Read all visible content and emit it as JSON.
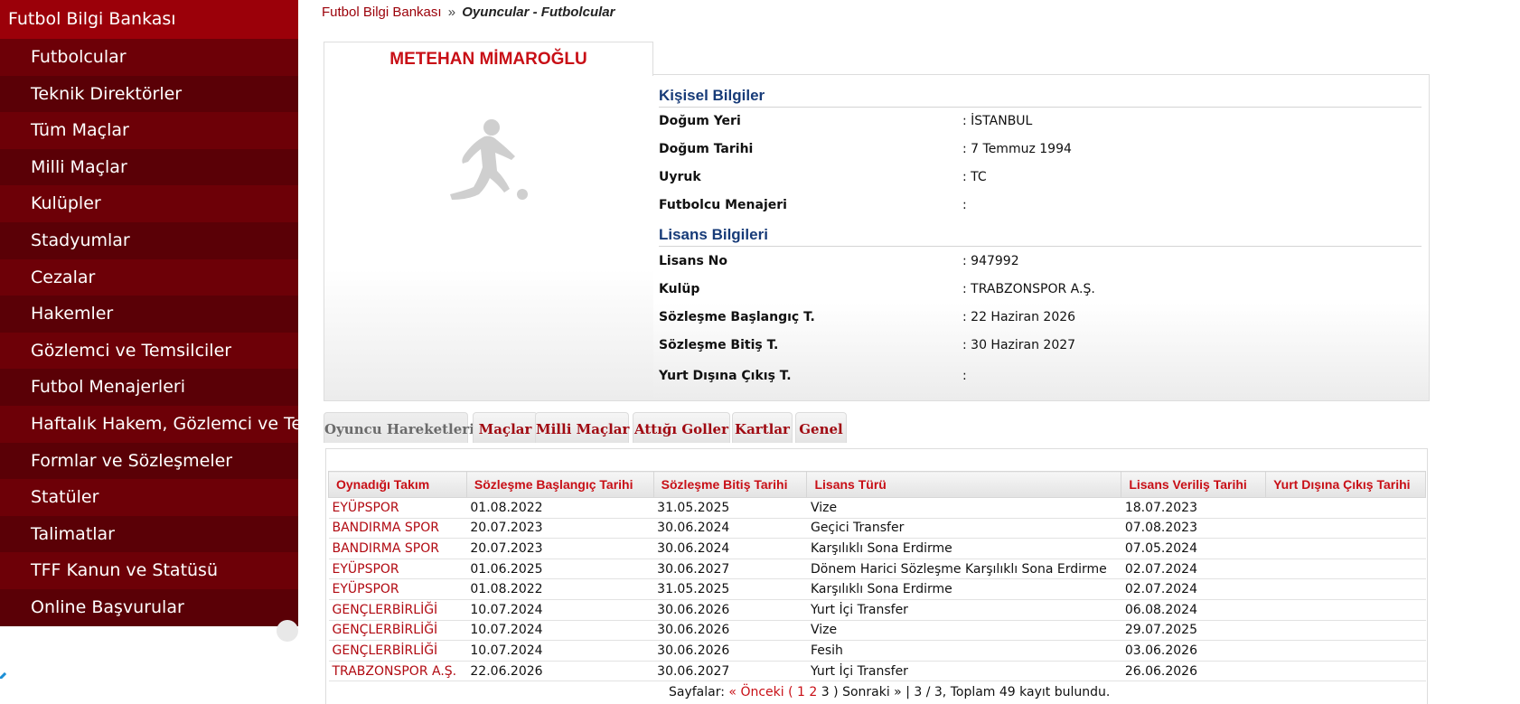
{
  "sidebar": {
    "title": "Futbol Bilgi Bankası",
    "items": [
      {
        "label": "Futbolcular"
      },
      {
        "label": "Teknik Direktörler"
      },
      {
        "label": "Tüm Maçlar"
      },
      {
        "label": "Milli Maçlar"
      },
      {
        "label": "Kulüpler"
      },
      {
        "label": "Stadyumlar"
      },
      {
        "label": "Cezalar"
      },
      {
        "label": "Hakemler"
      },
      {
        "label": "Gözlemci ve Temsilciler"
      },
      {
        "label": "Futbol Menajerleri"
      },
      {
        "label": "Haftalık Hakem, Gözlemci ve Temsi"
      },
      {
        "label": "Formlar ve Sözleşmeler"
      },
      {
        "label": "Statüler"
      },
      {
        "label": "Talimatlar"
      },
      {
        "label": "TFF Kanun ve Statüsü"
      },
      {
        "label": "Online Başvurular"
      }
    ]
  },
  "breadcrumb": {
    "root": "Futbol Bilgi Bankası",
    "separator": "»",
    "current": "Oyuncular - Futbolcular"
  },
  "player": {
    "name": "METEHAN MİMAROĞLU",
    "photo_icon": "player-silhouette-icon"
  },
  "personal": {
    "title": "Kişisel Bilgiler",
    "rows": [
      {
        "label": "Doğum Yeri",
        "value": ":  İSTANBUL"
      },
      {
        "label": "Doğum Tarihi",
        "value": ":  7 Temmuz 1994"
      },
      {
        "label": "Uyruk",
        "value": ":  TC"
      },
      {
        "label": "Futbolcu Menajeri",
        "value": ":"
      }
    ]
  },
  "license": {
    "title": "Lisans Bilgileri",
    "rows": [
      {
        "label": "Lisans No",
        "value": ": 947992"
      },
      {
        "label": "Kulüp",
        "value": ": TRABZONSPOR A.Ş."
      },
      {
        "label": "Sözleşme Başlangıç T.",
        "value": ": 22 Haziran 2026"
      },
      {
        "label": "Sözleşme Bitiş T.",
        "value": ": 30 Haziran 2027"
      },
      {
        "label": "Yurt Dışına Çıkış T.",
        "value": ":"
      }
    ]
  },
  "tabs": [
    {
      "label": "Oyuncu Hareketleri",
      "active": true
    },
    {
      "label": "Maçlar"
    },
    {
      "label": "Milli Maçlar"
    },
    {
      "label": "Attığı Goller"
    },
    {
      "label": "Kartlar"
    },
    {
      "label": "Genel"
    }
  ],
  "movements": {
    "headers": [
      "Oynadığı Takım",
      "Sözleşme Başlangıç Tarihi",
      "Sözleşme Bitiş Tarihi",
      "Lisans Türü",
      "Lisans Veriliş Tarihi",
      "Yurt Dışına Çıkış Tarihi"
    ],
    "rows": [
      [
        "EYÜPSPOR",
        "01.08.2022",
        "31.05.2025",
        "Vize",
        "18.07.2023",
        ""
      ],
      [
        "BANDIRMA SPOR",
        "20.07.2023",
        "30.06.2024",
        "Geçici Transfer",
        "07.08.2023",
        ""
      ],
      [
        "BANDIRMA SPOR",
        "20.07.2023",
        "30.06.2024",
        "Karşılıklı Sona Erdirme",
        "07.05.2024",
        ""
      ],
      [
        "EYÜPSPOR",
        "01.06.2025",
        "30.06.2027",
        "Dönem Harici Sözleşme Karşılıklı Sona Erdirme",
        "02.07.2024",
        ""
      ],
      [
        "EYÜPSPOR",
        "01.08.2022",
        "31.05.2025",
        "Karşılıklı Sona Erdirme",
        "02.07.2024",
        ""
      ],
      [
        "GENÇLERBİRLİĞİ",
        "10.07.2024",
        "30.06.2026",
        "Yurt İçi Transfer",
        "06.08.2024",
        ""
      ],
      [
        "GENÇLERBİRLİĞİ",
        "10.07.2024",
        "30.06.2026",
        "Vize",
        "29.07.2025",
        ""
      ],
      [
        "GENÇLERBİRLİĞİ",
        "10.07.2024",
        "30.06.2026",
        "Fesih",
        "03.06.2026",
        ""
      ],
      [
        "TRABZONSPOR A.Ş.",
        "22.06.2026",
        "30.06.2027",
        "Yurt İçi Transfer",
        "26.06.2026",
        ""
      ]
    ]
  },
  "pager": {
    "prefix": "Sayfalar:",
    "prev": "« Önceki",
    "open": "(",
    "pages": [
      "1",
      "2",
      "3"
    ],
    "close": ")",
    "next": "Sonraki »",
    "summary": "| 3 / 3, Toplam 49 kayıt bulundu."
  },
  "colors": {
    "brand_red": "#9b0009",
    "menu_dark": "#5a0006",
    "menu_mid": "#6d0007",
    "link_red": "#c80f16",
    "section_blue": "#173b78"
  }
}
